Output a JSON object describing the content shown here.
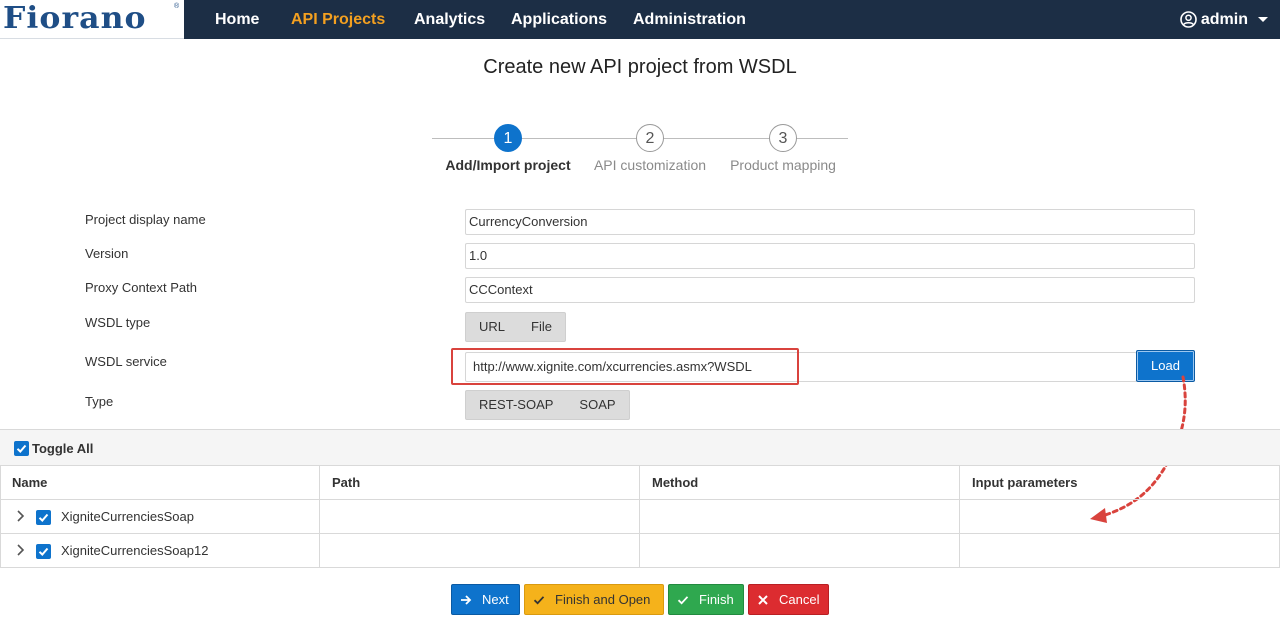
{
  "logo": {
    "text": "Fiorano"
  },
  "nav": {
    "items": [
      {
        "label": "Home",
        "active": false
      },
      {
        "label": "API Projects",
        "active": true
      },
      {
        "label": "Analytics",
        "active": false
      },
      {
        "label": "Applications",
        "active": false
      },
      {
        "label": "Administration",
        "active": false
      }
    ],
    "user": "admin"
  },
  "page": {
    "title": "Create new API project from WSDL"
  },
  "stepper": {
    "steps": [
      {
        "number": "1",
        "label": "Add/Import project",
        "active": true
      },
      {
        "number": "2",
        "label": "API customization",
        "active": false
      },
      {
        "number": "3",
        "label": "Product mapping",
        "active": false
      }
    ]
  },
  "form": {
    "project_display_name": {
      "label": "Project display name",
      "value": "CurrencyConversion"
    },
    "version": {
      "label": "Version",
      "value": "1.0"
    },
    "proxy_context_path": {
      "label": "Proxy Context Path",
      "value": "CCContext"
    },
    "wsdl_type": {
      "label": "WSDL type",
      "options": [
        "URL",
        "File"
      ]
    },
    "wsdl_service": {
      "label": "WSDL service",
      "value": "http://www.xignite.com/xcurrencies.asmx?WSDL",
      "load_label": "Load"
    },
    "type": {
      "label": "Type",
      "options": [
        "REST-SOAP",
        "SOAP"
      ]
    }
  },
  "table": {
    "toggle_all_label": "Toggle All",
    "columns": [
      "Name",
      "Path",
      "Method",
      "Input parameters"
    ],
    "rows": [
      {
        "name": "XigniteCurrenciesSoap",
        "checked": true
      },
      {
        "name": "XigniteCurrenciesSoap12",
        "checked": true
      }
    ]
  },
  "actions": {
    "next": "Next",
    "finish_and_open": "Finish and Open",
    "finish": "Finish",
    "cancel": "Cancel"
  },
  "colors": {
    "navbar": "#1c2e45",
    "nav_active": "#f3a020",
    "primary": "#0e73cc",
    "warning": "#f5b21b",
    "success": "#2fa84f",
    "danger": "#dc2c30",
    "highlight": "#d9433d"
  }
}
